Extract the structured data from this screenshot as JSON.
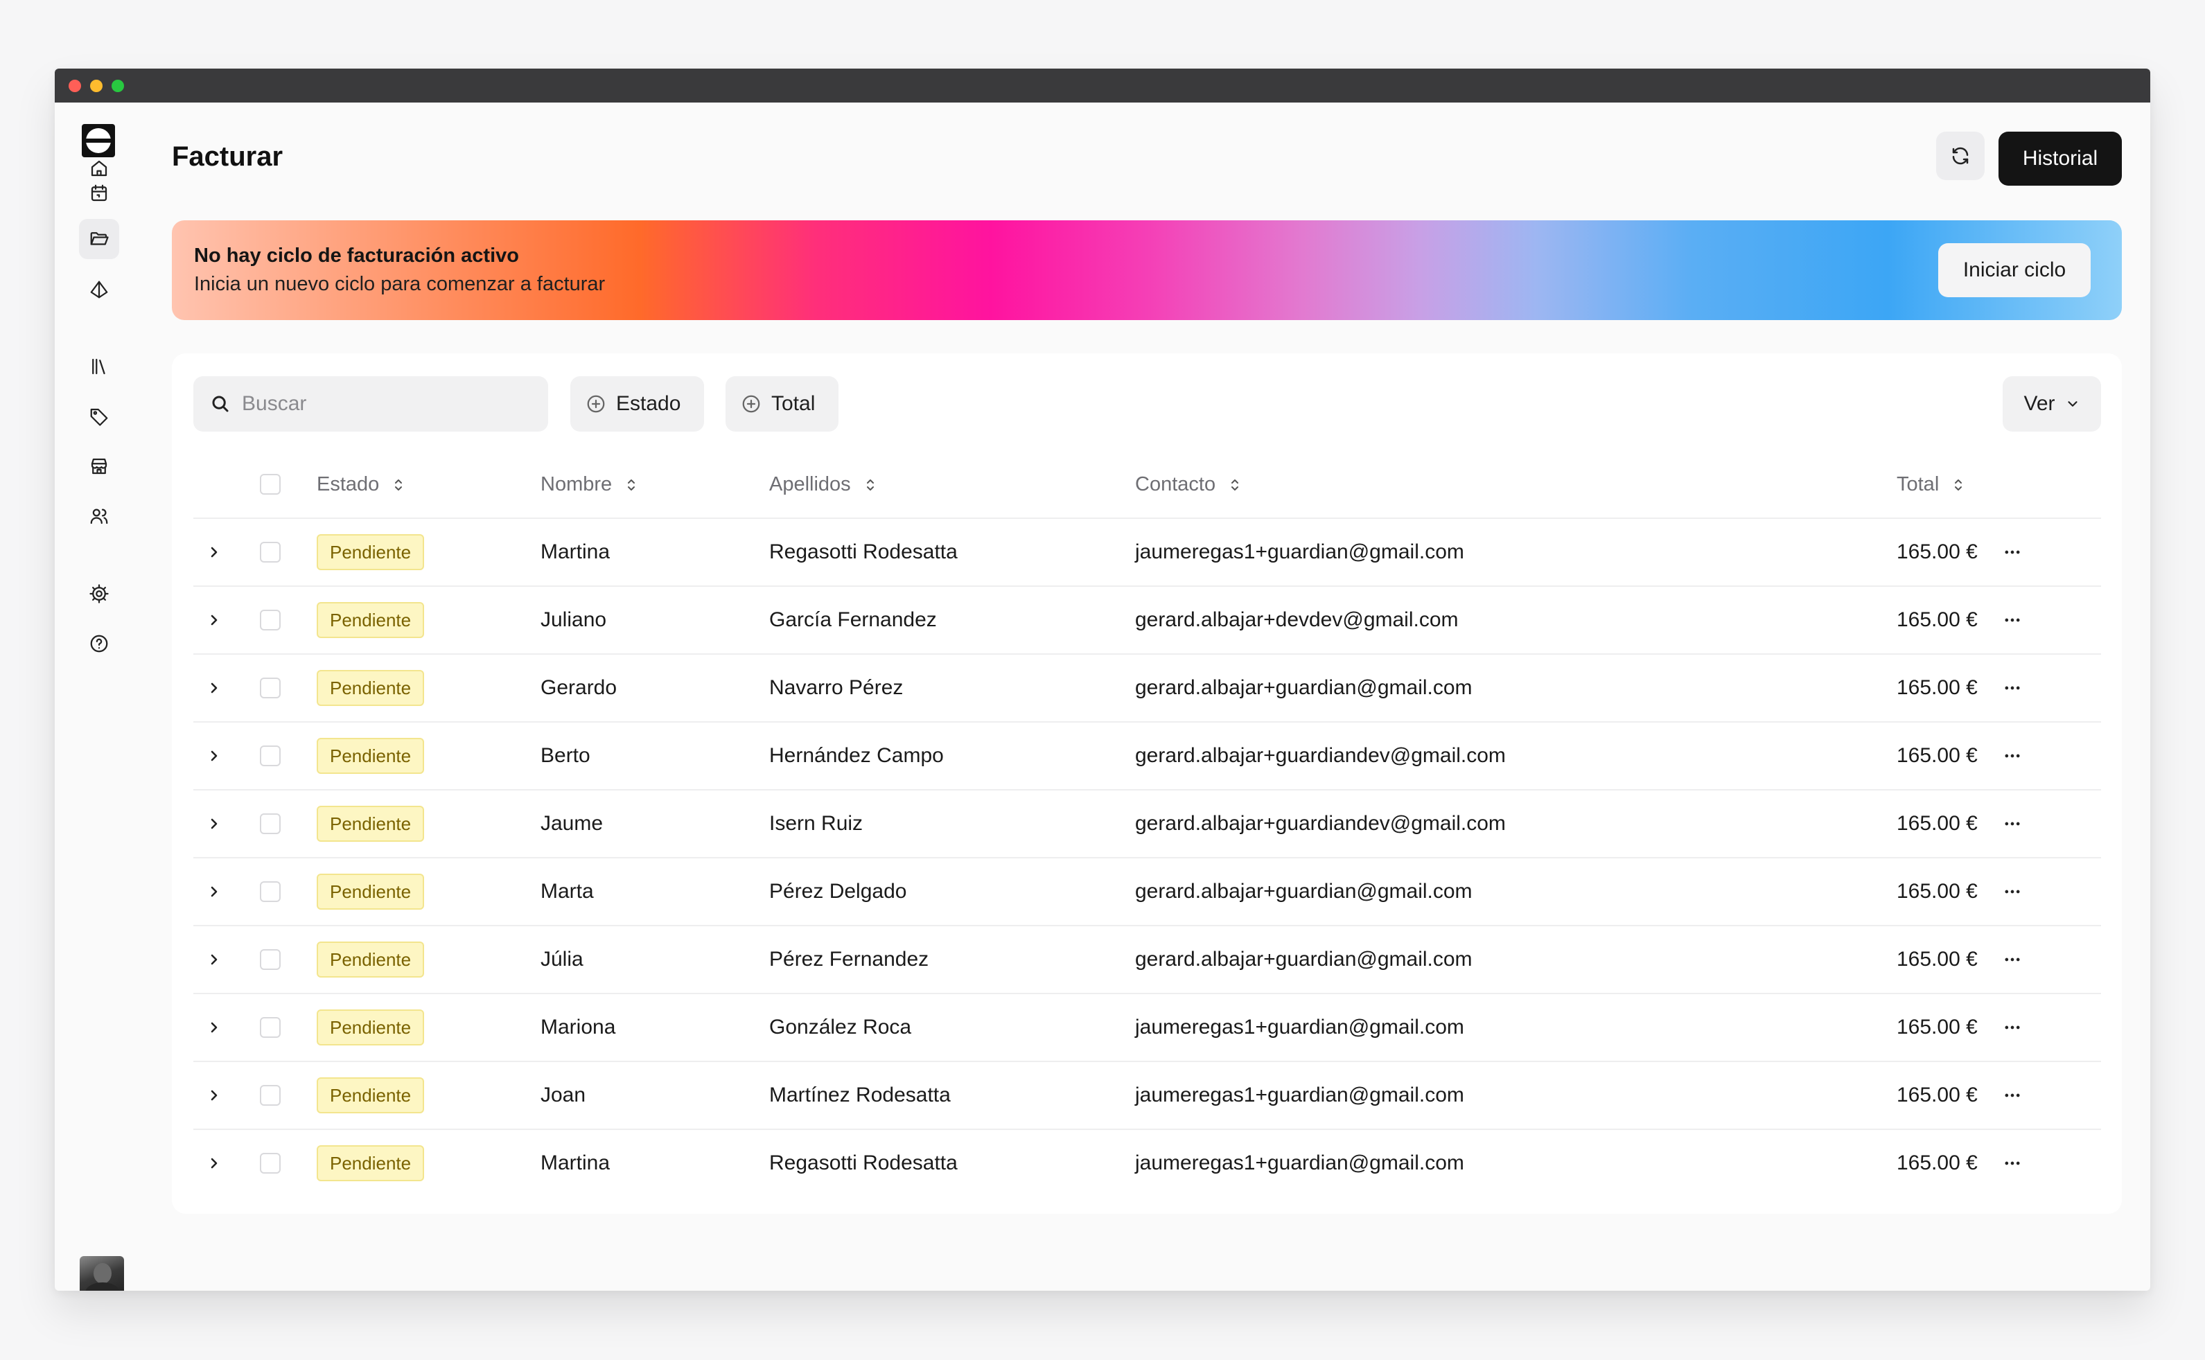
{
  "page": {
    "title": "Facturar",
    "history_label": "Historial"
  },
  "banner": {
    "title": "No hay ciclo de facturación activo",
    "subtitle": "Inicia un nuevo ciclo para comenzar a facturar",
    "button_label": "Iniciar ciclo"
  },
  "toolbar": {
    "search_placeholder": "Buscar",
    "filter_estado": "Estado",
    "filter_total": "Total",
    "view_label": "Ver"
  },
  "table": {
    "headers": {
      "estado": "Estado",
      "nombre": "Nombre",
      "apellidos": "Apellidos",
      "contacto": "Contacto",
      "total": "Total"
    },
    "rows": [
      {
        "estado": "Pendiente",
        "nombre": "Martina",
        "apellidos": "Regasotti Rodesatta",
        "contacto": "jaumeregas1+guardian@gmail.com",
        "total": "165.00 €"
      },
      {
        "estado": "Pendiente",
        "nombre": "Juliano",
        "apellidos": "García Fernandez",
        "contacto": "gerard.albajar+devdev@gmail.com",
        "total": "165.00 €"
      },
      {
        "estado": "Pendiente",
        "nombre": "Gerardo",
        "apellidos": "Navarro Pérez",
        "contacto": "gerard.albajar+guardian@gmail.com",
        "total": "165.00 €"
      },
      {
        "estado": "Pendiente",
        "nombre": "Berto",
        "apellidos": "Hernández Campo",
        "contacto": "gerard.albajar+guardiandev@gmail.com",
        "total": "165.00 €"
      },
      {
        "estado": "Pendiente",
        "nombre": "Jaume",
        "apellidos": "Isern Ruiz",
        "contacto": "gerard.albajar+guardiandev@gmail.com",
        "total": "165.00 €"
      },
      {
        "estado": "Pendiente",
        "nombre": "Marta",
        "apellidos": "Pérez Delgado",
        "contacto": "gerard.albajar+guardian@gmail.com",
        "total": "165.00 €"
      },
      {
        "estado": "Pendiente",
        "nombre": "Júlia",
        "apellidos": "Pérez Fernandez",
        "contacto": "gerard.albajar+guardian@gmail.com",
        "total": "165.00 €"
      },
      {
        "estado": "Pendiente",
        "nombre": "Mariona",
        "apellidos": "González Roca",
        "contacto": "jaumeregas1+guardian@gmail.com",
        "total": "165.00 €"
      },
      {
        "estado": "Pendiente",
        "nombre": "Joan",
        "apellidos": "Martínez Rodesatta",
        "contacto": "jaumeregas1+guardian@gmail.com",
        "total": "165.00 €"
      },
      {
        "estado": "Pendiente",
        "nombre": "Martina",
        "apellidos": "Regasotti Rodesatta",
        "contacto": "jaumeregas1+guardian@gmail.com",
        "total": "165.00 €"
      }
    ]
  },
  "sidebar": {
    "items": [
      {
        "icon": "home-icon"
      },
      {
        "icon": "calendar-icon"
      },
      {
        "icon": "folder-open-icon",
        "active": true
      },
      {
        "icon": "pyramid-icon"
      },
      {
        "icon": "library-icon"
      },
      {
        "icon": "tag-icon"
      },
      {
        "icon": "store-icon"
      },
      {
        "icon": "users-icon"
      },
      {
        "icon": "gear-icon"
      },
      {
        "icon": "help-icon"
      }
    ]
  },
  "colors": {
    "badge_bg": "#fdf6c3",
    "badge_text": "#7a6200",
    "primary_button": "#141414"
  }
}
